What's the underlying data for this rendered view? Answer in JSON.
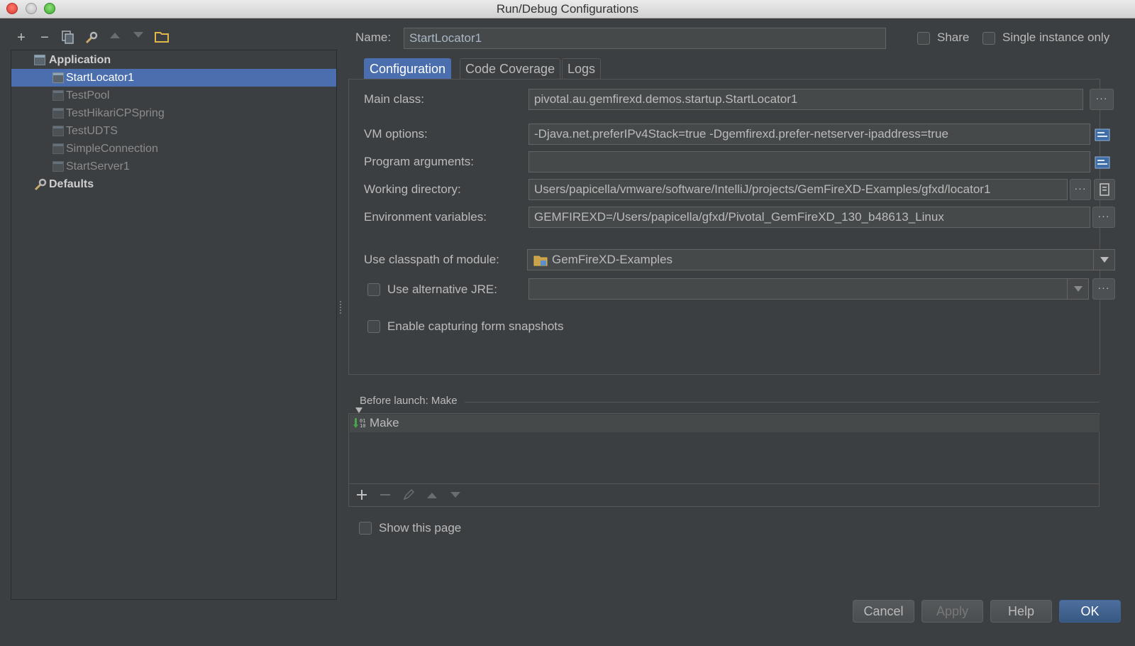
{
  "window": {
    "title": "Run/Debug Configurations"
  },
  "toolbar": {
    "add": "+",
    "remove": "−"
  },
  "tree": {
    "application_label": "Application",
    "items": [
      {
        "label": "StartLocator1",
        "selected": true
      },
      {
        "label": "TestPool"
      },
      {
        "label": "TestHikariCPSpring"
      },
      {
        "label": "TestUDTS"
      },
      {
        "label": "SimpleConnection"
      },
      {
        "label": "StartServer1"
      }
    ],
    "defaults_label": "Defaults"
  },
  "header": {
    "name_label": "Name:",
    "name_value": "StartLocator1",
    "share_label": "Share",
    "single_instance_label": "Single instance only"
  },
  "tabs": [
    {
      "label": "Configuration",
      "active": true
    },
    {
      "label": "Code Coverage"
    },
    {
      "label": "Logs"
    }
  ],
  "form": {
    "main_class_label": "Main class:",
    "main_class_value": "pivotal.au.gemfirexd.demos.startup.StartLocator1",
    "vm_options_label": "VM options:",
    "vm_options_value": "-Djava.net.preferIPv4Stack=true  -Dgemfirexd.prefer-netserver-ipaddress=true",
    "program_args_label": "Program arguments:",
    "program_args_value": "",
    "working_dir_label": "Working directory:",
    "working_dir_value": "Users/papicella/vmware/software/IntelliJ/projects/GemFireXD-Examples/gfxd/locator1",
    "env_vars_label": "Environment variables:",
    "env_vars_value": "GEMFIREXD=/Users/papicella/gfxd/Pivotal_GemFireXD_130_b48613_Linux",
    "classpath_label": "Use classpath of module:",
    "classpath_value": "GemFireXD-Examples",
    "alt_jre_label": "Use alternative JRE:",
    "alt_jre_value": "",
    "snapshots_label": "Enable capturing form snapshots",
    "ellipsis": "···"
  },
  "before_launch": {
    "title": "Before launch: Make",
    "items": [
      {
        "label": "Make"
      }
    ],
    "show_page_label": "Show this page"
  },
  "buttons": {
    "cancel": "Cancel",
    "apply": "Apply",
    "help": "Help",
    "ok": "OK"
  }
}
